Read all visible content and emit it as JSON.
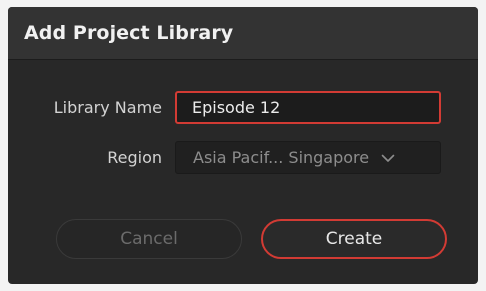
{
  "dialog": {
    "title": "Add Project Library"
  },
  "form": {
    "library_name": {
      "label": "Library Name",
      "value": "Episode 12"
    },
    "region": {
      "label": "Region",
      "selected": "Asia Pacif... Singapore",
      "icon": "chevron-down-icon"
    }
  },
  "buttons": {
    "cancel_label": "Cancel",
    "create_label": "Create"
  },
  "colors": {
    "accent": "#d23b34",
    "dialog_bg": "#282828",
    "titlebar_bg": "#333333"
  }
}
